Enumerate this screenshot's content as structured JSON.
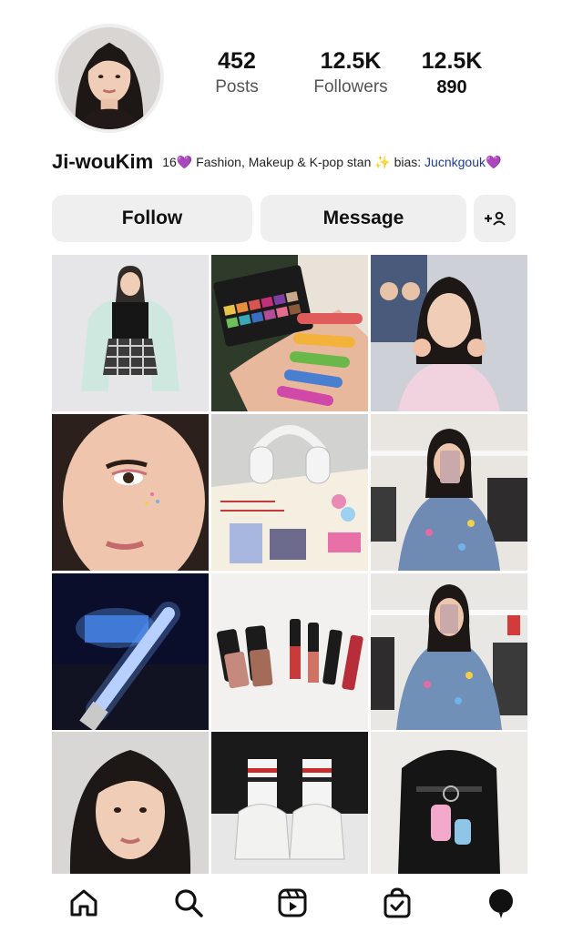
{
  "profile": {
    "username": "Ji-wouKim",
    "bio_prefix": "16",
    "bio_heart": "💜",
    "bio_text": " Fashion, Makeup & K-pop stan ",
    "bio_spark": "✨",
    "bio_bias_label": " bias: ",
    "bio_bias_name": "Jucnkgouk",
    "bio_heart_end": "💜"
  },
  "stats": [
    {
      "value": "452",
      "label": "Posts"
    },
    {
      "value": "12.5K",
      "label": "Followers"
    },
    {
      "value": "12.5K",
      "label": "890"
    }
  ],
  "buttons": {
    "follow": "Follow",
    "message": "Message",
    "add_friend": "+≗"
  },
  "grid": {
    "posts": [
      "outfit-photo",
      "eyeshadow-swatch",
      "kpop-heart-selfie",
      "makeup-closeup",
      "headphones-journal",
      "mirror-selfie-store",
      "concert-lightstick",
      "lipstick-collection",
      "mirror-selfie-jacket",
      "portrait-selfie",
      "sneakers-socks",
      "backpack-keychain"
    ]
  },
  "nav": {
    "icons": [
      "home-icon",
      "search-icon",
      "reels-icon",
      "shop-icon",
      "profile-icon"
    ]
  },
  "colors": {
    "button_bg": "#efefef",
    "accent_purple": "#b23bd1",
    "bias_blue": "#1f3a93"
  }
}
